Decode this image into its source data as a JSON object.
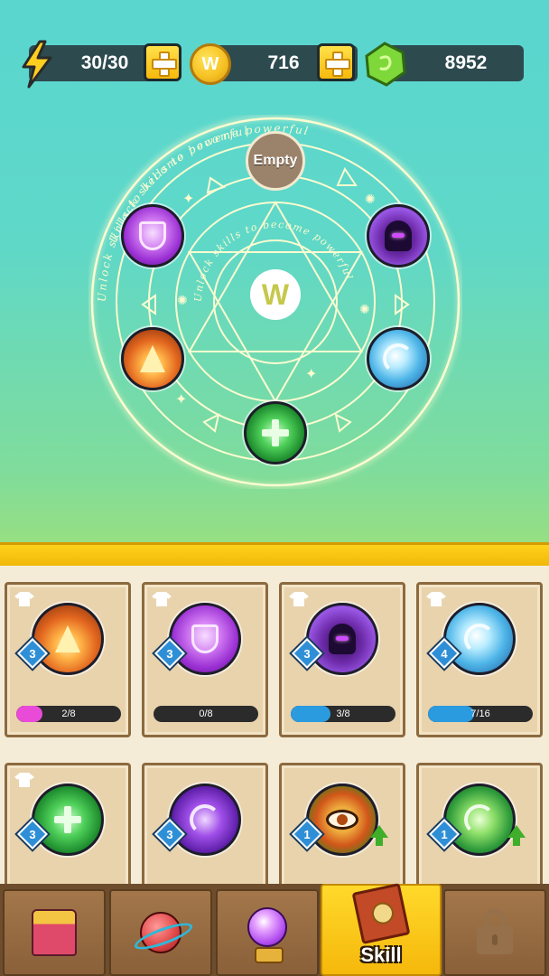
{
  "resources": {
    "energy": "30/30",
    "coins": "716",
    "gems": "8952",
    "coin_symbol": "W"
  },
  "magic_circle": {
    "empty_slot_label": "Empty",
    "center_symbol": "W",
    "inscription": "Unlock skills to become powerful",
    "glow_color": "#f6f8b0",
    "equipped": [
      {
        "slot": "top",
        "skill": "empty"
      },
      {
        "slot": "upper-right",
        "skill": "shadow-hood",
        "icon": "hooded-figure-icon"
      },
      {
        "slot": "lower-right",
        "skill": "ice-blast",
        "icon": "ice-swirl-icon"
      },
      {
        "slot": "bottom",
        "skill": "heal",
        "icon": "heal-cross-icon"
      },
      {
        "slot": "lower-left",
        "skill": "fire-wings",
        "icon": "fire-wings-icon"
      },
      {
        "slot": "upper-left",
        "skill": "arcane-shield",
        "icon": "shield-icon"
      }
    ]
  },
  "skills": [
    {
      "icon": "fire-wings-icon",
      "level": "3",
      "progress": "2/8",
      "fill_fraction": 0.25,
      "bar_color": "#e94bd8"
    },
    {
      "icon": "shield-icon",
      "level": "3",
      "progress": "0/8",
      "fill_fraction": 0.0,
      "bar_color": "#e94bd8"
    },
    {
      "icon": "hooded-figure-icon",
      "level": "3",
      "progress": "3/8",
      "fill_fraction": 0.375,
      "bar_color": "#2b9be0"
    },
    {
      "icon": "ice-swirl-icon",
      "level": "4",
      "progress": "7/16",
      "fill_fraction": 0.4375,
      "bar_color": "#2b9be0"
    },
    {
      "icon": "heal-cross-icon",
      "level": "3"
    },
    {
      "icon": "vortex-icon",
      "level": "3"
    },
    {
      "icon": "fire-eye-icon",
      "level": "1",
      "upgradable": true
    },
    {
      "icon": "lightning-storm-icon",
      "level": "1",
      "upgradable": true
    }
  ],
  "nav": {
    "tabs": [
      {
        "icon": "shop-icon",
        "label": ""
      },
      {
        "icon": "planet-icon",
        "label": ""
      },
      {
        "icon": "crystal-ball-icon",
        "label": ""
      },
      {
        "icon": "spellbook-icon",
        "label": "Skill",
        "active": true
      },
      {
        "icon": "lock-icon",
        "label": "",
        "locked": true
      }
    ]
  },
  "colors": {
    "panel_accent": "#ffd21a",
    "card_bg": "#e8d3ad",
    "nav_bg": "#6d4d2c",
    "active_tab": "#ffd92b"
  }
}
